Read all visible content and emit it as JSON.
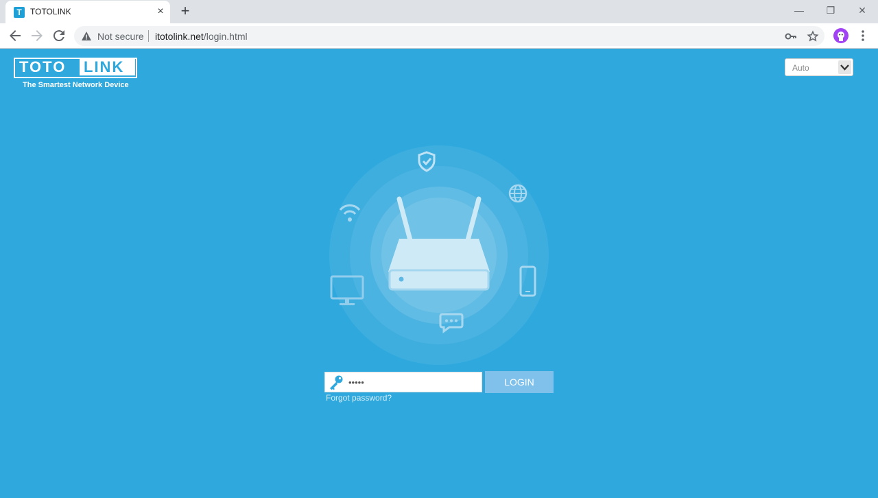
{
  "browser": {
    "tab_title": "TOTOLINK",
    "favicon_letter": "T",
    "new_tab_symbol": "+",
    "security_label": "Not secure",
    "url_host": "itotolink.net",
    "url_path": "/login.html"
  },
  "header": {
    "logo_left": "TOTO",
    "logo_right": "LINK",
    "tagline": "The Smartest Network Device",
    "language": "Auto"
  },
  "login": {
    "password_value": "admin",
    "login_label": "LOGIN",
    "forgot_label": "Forgot password?"
  },
  "icons": [
    "shield-check-icon",
    "globe-icon",
    "wifi-icon",
    "monitor-icon",
    "phone-icon",
    "chat-icon",
    "router-icon",
    "key-icon"
  ],
  "colors": {
    "background": "#2ea8dd",
    "button": "#7fc1ea"
  }
}
